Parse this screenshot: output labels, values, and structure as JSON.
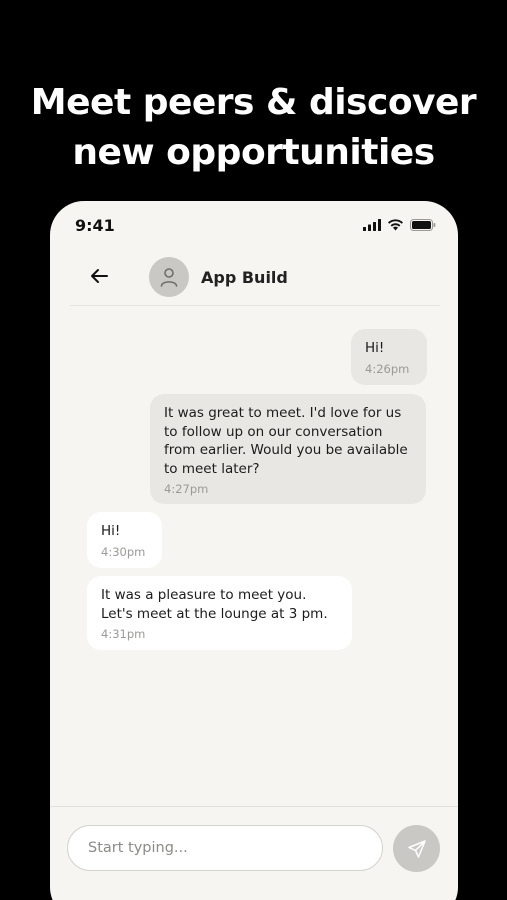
{
  "headline": {
    "line1": "Meet peers & discover",
    "line2": "new opportunities"
  },
  "status_bar": {
    "time": "9:41",
    "icons": [
      "signal-icon",
      "wifi-icon",
      "battery-icon"
    ]
  },
  "header": {
    "back_icon": "arrow-left-icon",
    "avatar_icon": "user-icon",
    "title": "App Build"
  },
  "messages": [
    {
      "direction": "outgoing",
      "text": "Hi!",
      "time": "4:26pm"
    },
    {
      "direction": "outgoing",
      "text": "It was great to meet. I'd love for us to follow up on our conversation from earlier. Would you be available to meet later?",
      "time": "4:27pm"
    },
    {
      "direction": "incoming",
      "text": "Hi!",
      "time": "4:30pm"
    },
    {
      "direction": "incoming",
      "text": "It was a pleasure to meet you. Let's meet at the lounge at 3 pm.",
      "time": "4:31pm"
    }
  ],
  "composer": {
    "placeholder": "Start typing...",
    "value": "",
    "send_icon": "send-icon"
  },
  "colors": {
    "background": "#000000",
    "phone_bg": "#f6f5f1",
    "bubble_outgoing": "#e8e7e3",
    "bubble_incoming": "#ffffff",
    "accent_grey": "#c9c8c5"
  }
}
